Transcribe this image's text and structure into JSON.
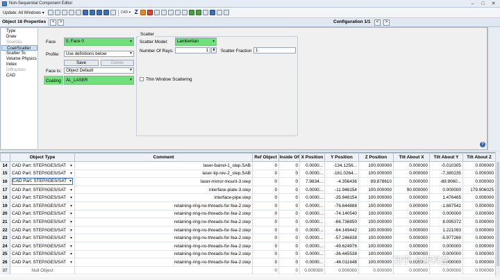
{
  "window": {
    "title": "Non-Sequential Component Editor"
  },
  "toolbar": {
    "update_label": "Update: All Windows ▾",
    "cad_label": "CAD ▾",
    "z_label": "Z"
  },
  "objbar": {
    "title": "Object  16 Properties",
    "prev": "<",
    "next": ">",
    "config": "Configuration 1/1",
    "cfg_prev": "<",
    "cfg_next": ">"
  },
  "nav": {
    "items": [
      {
        "label": "Type",
        "state": "normal"
      },
      {
        "label": "Draw",
        "state": "normal"
      },
      {
        "label": "Sources",
        "state": "disabled"
      },
      {
        "label": "Coat/Scatter",
        "state": "selected"
      },
      {
        "label": "Scatter To",
        "state": "normal"
      },
      {
        "label": "Volume Physics",
        "state": "normal"
      },
      {
        "label": "Index",
        "state": "normal"
      },
      {
        "label": "Diffraction",
        "state": "disabled"
      },
      {
        "label": "CAD",
        "state": "normal"
      }
    ]
  },
  "form": {
    "face_label": "Face",
    "face_value": "0, Face 0",
    "profile_label": "Profile:",
    "profile_value": "Use definitions below",
    "save_label": "Save",
    "delete_label": "Delete",
    "face_is_label": "Face Is:",
    "face_is_value": "Object Default",
    "coating_label": "Coating",
    "coating_value": "AL_LASER"
  },
  "scatter": {
    "group_label": "Scatter",
    "model_label": "Scatter Model:",
    "model_value": "Lambertian",
    "rays_label": "Number Of Rays:",
    "rays_value": "1",
    "fraction_label": "Scatter Fraction",
    "fraction_value": "1",
    "thin_window_label": "Thin Window Scattering",
    "help": "?"
  },
  "table": {
    "headers": [
      "",
      "Object Type",
      "Comment",
      "Ref Object",
      "Inside Of",
      "X Position",
      "Y Position",
      "Z Position",
      "Tilt About X",
      "Tilt About Y",
      "Tilt About Z"
    ],
    "rows": [
      {
        "n": "14",
        "type": "CAD Part: STEP/IGES/SAT",
        "comment": "laser-barrel-1_step.SAB",
        "ref": "0",
        "inside": "0",
        "x": "0.0000...",
        "y": "-134.1256...",
        "z": "100.000000",
        "tx": "0.000000",
        "ty": "-0.010305",
        "tz": "0.000000"
      },
      {
        "n": "15",
        "type": "CAD Part: STEP/IGES/SAT",
        "comment": "laser-tip-rev-2_step.SAB",
        "ref": "0",
        "inside": "0",
        "x": "0.0000...",
        "y": "-161.0264...",
        "z": "100.000000",
        "tx": "0.000000",
        "ty": "-7.380235",
        "tz": "0.000000"
      },
      {
        "n": "16",
        "type": "CAD Part: STEP/IGES/SAT",
        "comment": "laser-mirror-mount-3.step",
        "ref": "0",
        "inside": "0",
        "x": "7.9834...",
        "y": "-4.356436",
        "z": "89.878610",
        "tx": "0.000000",
        "ty": "-89.9060...",
        "tz": "0.000000"
      },
      {
        "n": "17",
        "type": "CAD Part: STEP/IGES/SAT",
        "comment": "interface-plate-3.step",
        "ref": "0",
        "inside": "0",
        "x": "0.0000...",
        "y": "-11.948154",
        "z": "100.000000",
        "tx": "90.000000",
        "ty": "0.000000",
        "tz": "179.906025"
      },
      {
        "n": "18",
        "type": "CAD Part: STEP/IGES/SAT",
        "comment": "interface-pipe.step",
        "ref": "0",
        "inside": "0",
        "x": "0.0000...",
        "y": "-35.948154",
        "z": "100.000000",
        "tx": "0.000000",
        "ty": "1.476465",
        "tz": "0.000000"
      },
      {
        "n": "19",
        "type": "CAD Part: STEP/IGES/SAT",
        "comment": "retaining-ring-no-threads-for-fea-2.step",
        "ref": "0",
        "inside": "0",
        "x": "0.0000...",
        "y": "-76.644888",
        "z": "100.000000",
        "tx": "0.000000",
        "ty": "-1.887541",
        "tz": "0.000000"
      },
      {
        "n": "20",
        "type": "CAD Part: STEP/IGES/SAT",
        "comment": "retaining-ring-no-threads-for-fea-2.step",
        "ref": "0",
        "inside": "0",
        "x": "0.0000...",
        "y": "-74.140540",
        "z": "100.000000",
        "tx": "0.000000",
        "ty": "0.000000",
        "tz": "0.000000"
      },
      {
        "n": "21",
        "type": "CAD Part: STEP/IGES/SAT",
        "comment": "retaining-ring-no-threads-for-fea-2.step",
        "ref": "0",
        "inside": "0",
        "x": "0.0000...",
        "y": "-66.736850",
        "z": "100.000000",
        "tx": "0.000000",
        "ty": "8.095372",
        "tz": "0.000000"
      },
      {
        "n": "22",
        "type": "CAD Part: STEP/IGES/SAT",
        "comment": "retaining-ring-no-threads-for-fea-2.step",
        "ref": "0",
        "inside": "0",
        "x": "0.0000...",
        "y": "-64.149442",
        "z": "100.000000",
        "tx": "0.000000",
        "ty": "1.221093",
        "tz": "0.000000"
      },
      {
        "n": "23",
        "type": "CAD Part: STEP/IGES/SAT",
        "comment": "retaining-ring-no-threads-for-fea-2.step",
        "ref": "0",
        "inside": "0",
        "x": "0.0000...",
        "y": "-57.246838",
        "z": "100.000000",
        "tx": "0.000000",
        "ty": "-5.977269",
        "tz": "0.000000"
      },
      {
        "n": "24",
        "type": "CAD Part: STEP/IGES/SAT",
        "comment": "retaining-ring-no-threads-for-fea-2.step",
        "ref": "0",
        "inside": "0",
        "x": "0.0000...",
        "y": "-49.624976",
        "z": "100.000000",
        "tx": "0.000000",
        "ty": "0.000000",
        "tz": "0.000000"
      },
      {
        "n": "25",
        "type": "CAD Part: STEP/IGES/SAT",
        "comment": "retaining-ring-no-threads-for-fea-2.step",
        "ref": "0",
        "inside": "0",
        "x": "0.0000...",
        "y": "-36.445538",
        "z": "100.000000",
        "tx": "0.000000",
        "ty": "0.000000",
        "tz": "0.000000"
      },
      {
        "n": "26",
        "type": "CAD Part: STEP/IGES/SAT",
        "comment": "retaining-ring-no-threads-for-fea-2.step",
        "ref": "0",
        "inside": "0",
        "x": "0.0000...",
        "y": "-46.011648",
        "z": "100.000000",
        "tx": "0.000000",
        "ty": "0.000000",
        "tz": "0.000000"
      },
      {
        "n": "37",
        "type": "Null Object",
        "comment": "",
        "ref": "0",
        "inside": "0",
        "x": "0.000000",
        "y": "0.000000",
        "z": "0.000000",
        "tx": "0.000000",
        "ty": "0.000000",
        "tz": "0.000000"
      }
    ]
  },
  "watermark": "知乎 @新科益"
}
